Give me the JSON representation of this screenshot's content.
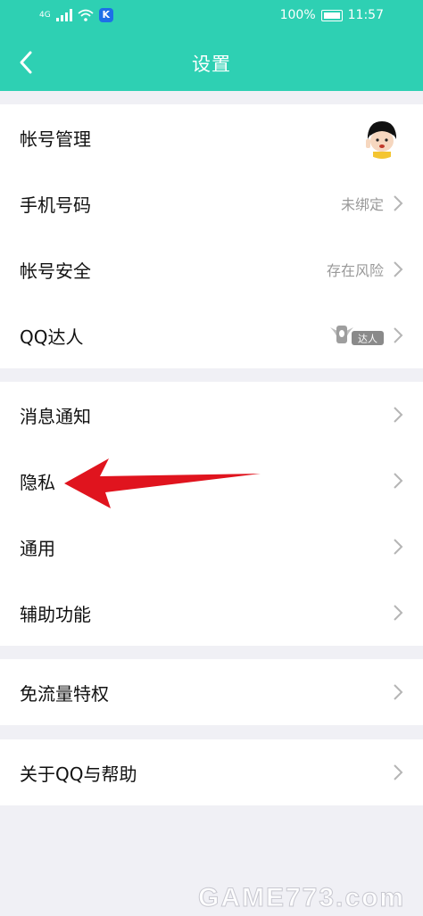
{
  "status_bar": {
    "signal": "4G",
    "battery": "100%",
    "time": "11:57",
    "k_badge": "K"
  },
  "header": {
    "title": "设置"
  },
  "groups": [
    {
      "items": [
        {
          "label": "帐号管理",
          "value": ""
        },
        {
          "label": "手机号码",
          "value": "未绑定"
        },
        {
          "label": "帐号安全",
          "value": "存在风险"
        },
        {
          "label": "QQ达人",
          "value": "达人"
        }
      ]
    },
    {
      "items": [
        {
          "label": "消息通知"
        },
        {
          "label": "隐私"
        },
        {
          "label": "通用"
        },
        {
          "label": "辅助功能"
        }
      ]
    },
    {
      "items": [
        {
          "label": "免流量特权"
        }
      ]
    },
    {
      "items": [
        {
          "label": "关于QQ与帮助"
        }
      ]
    }
  ],
  "watermark": "GAME773.com",
  "colors": {
    "header": "#2ed0b3",
    "background": "#f0f0f5",
    "arrow": "#e0141e"
  }
}
